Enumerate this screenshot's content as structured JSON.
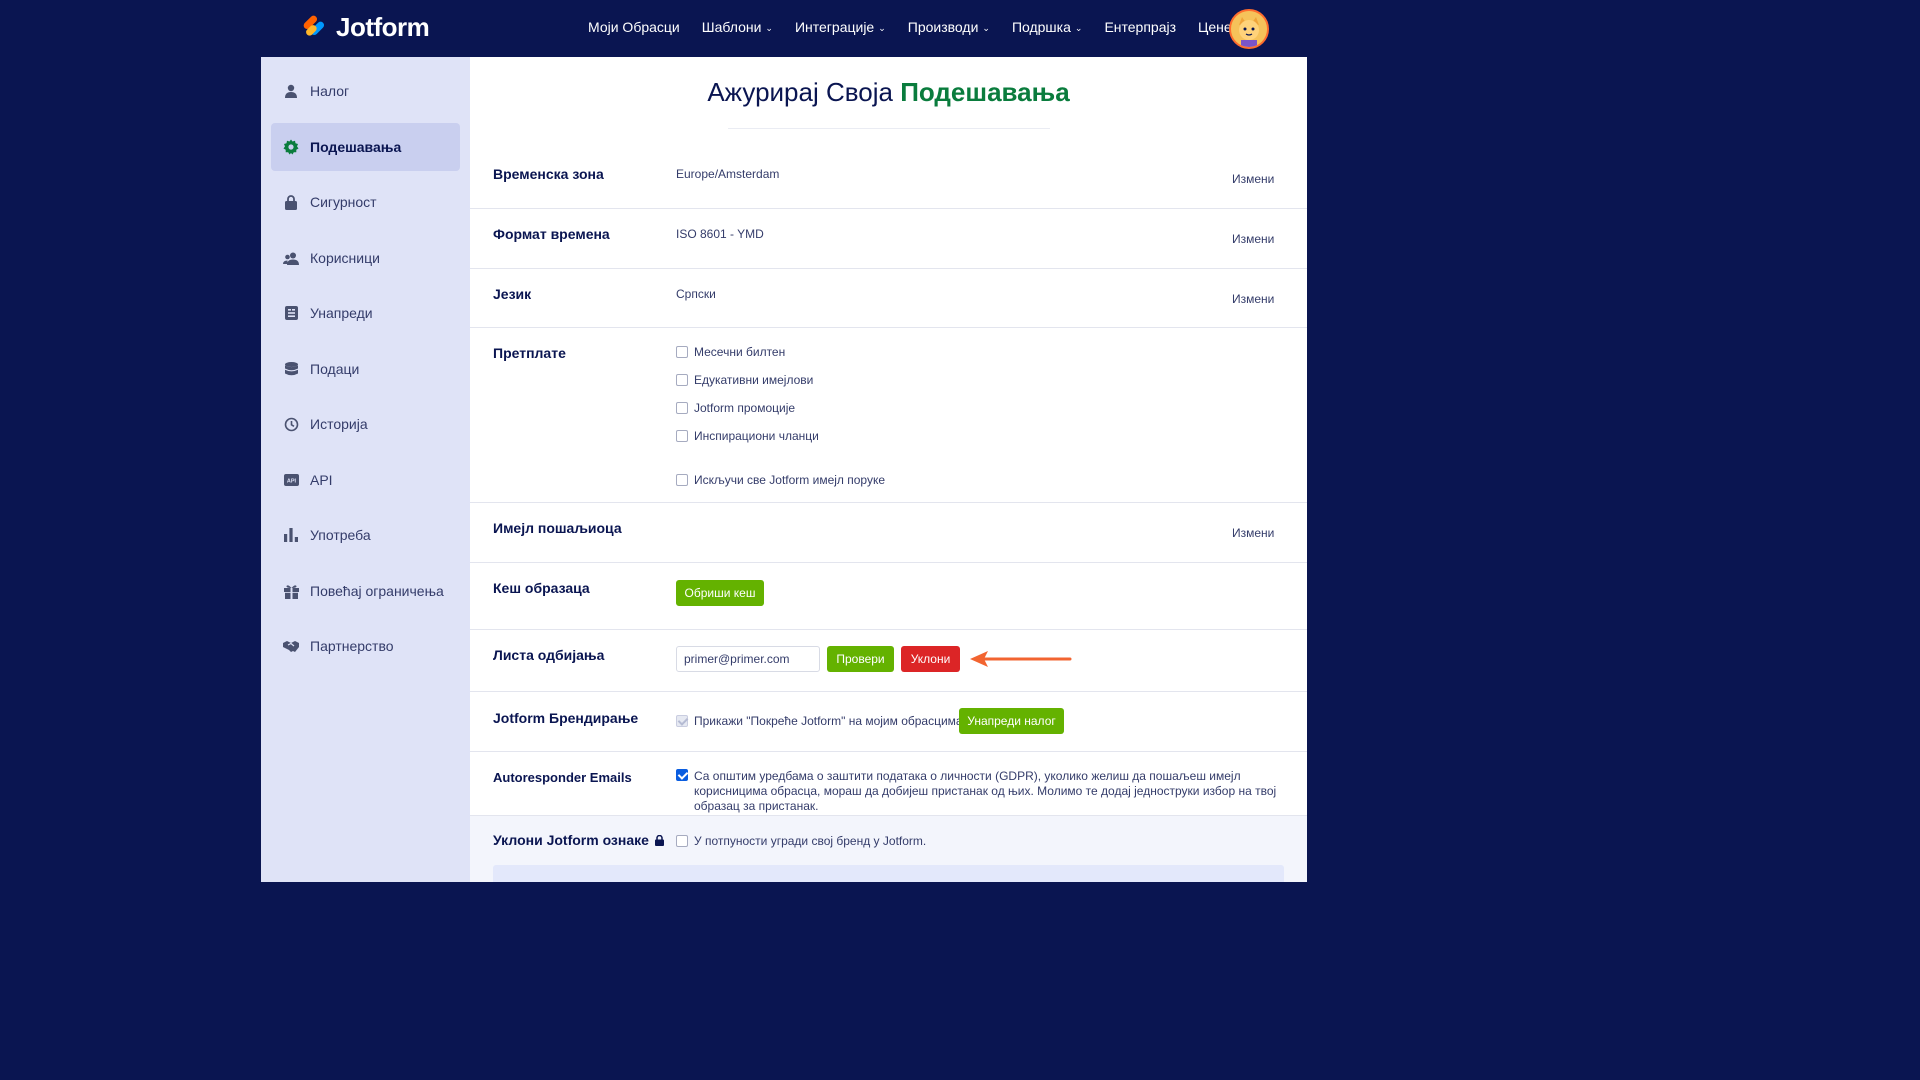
{
  "brand": {
    "name": "Jotform",
    "colors": {
      "navy": "#0a1551",
      "green": "#0a7c3d",
      "button_green": "#64b200",
      "red": "#dc2526",
      "orange": "#ff6d2e"
    }
  },
  "nav": {
    "items": [
      {
        "label": "Моји Обрасци",
        "dropdown": false
      },
      {
        "label": "Шаблони",
        "dropdown": true
      },
      {
        "label": "Интеграције",
        "dropdown": true
      },
      {
        "label": "Производи",
        "dropdown": true
      },
      {
        "label": "Подршка",
        "dropdown": true
      },
      {
        "label": "Ентерпрајз",
        "dropdown": false
      },
      {
        "label": "Цене",
        "dropdown": false
      }
    ]
  },
  "sidebar": {
    "items": [
      {
        "label": "Налог",
        "icon": "user-icon"
      },
      {
        "label": "Подешавања",
        "icon": "gear-icon",
        "active": true
      },
      {
        "label": "Сигурност",
        "icon": "lock-icon"
      },
      {
        "label": "Корисници",
        "icon": "users-icon"
      },
      {
        "label": "Унапреди",
        "icon": "upgrade-icon"
      },
      {
        "label": "Подаци",
        "icon": "database-icon"
      },
      {
        "label": "Историја",
        "icon": "history-icon"
      },
      {
        "label": "API",
        "icon": "api-icon"
      },
      {
        "label": "Употреба",
        "icon": "chart-icon"
      },
      {
        "label": "Повећај ограничења",
        "icon": "gift-icon"
      },
      {
        "label": "Партнерство",
        "icon": "handshake-icon"
      }
    ]
  },
  "page": {
    "title_prefix": "Ажурирај Своја",
    "title_accent": "Подешавања",
    "edit_label": "Измени"
  },
  "settings": {
    "timezone": {
      "label": "Временска зона",
      "value": "Europe/Amsterdam"
    },
    "time_format": {
      "label": "Формат времена",
      "value": "ISO 8601 - YMD"
    },
    "language": {
      "label": "Језик",
      "value": "Српски"
    },
    "subscriptions": {
      "label": "Претплате",
      "options": [
        "Месечни билтен",
        "Едукативни имејлови",
        "Jotform промоције",
        "Инспирациони чланци"
      ],
      "unsubscribe_all": "Искључи све Jotform имејл поруке"
    },
    "sender_email": {
      "label": "Имејл пошаљиоца"
    },
    "form_cache": {
      "label": "Кеш образаца",
      "button": "Обриши кеш"
    },
    "bounce_list": {
      "label": "Листа одбијања",
      "input_value": "primer@primer.com",
      "check_button": "Провери",
      "remove_button": "Уклони"
    },
    "branding": {
      "label": "Jotform Брендирање",
      "checkbox": "Прикажи \"Покреће Jotform\" на мојим обрасцима",
      "button": "Унапреди налог"
    },
    "autoresponder": {
      "label": "Autoresponder Emails",
      "text": "Са општим уредбама о заштити података о личности (GDPR), уколико желиш да пошаљеш имејл корисницима обрасца, мораш да добијеш пристанак од њих. Молимо те додај једноструки избор на твој образац за пристанак."
    },
    "remove_marks": {
      "label": "Уклони Jotform ознаке",
      "checkbox": "У потпуности угради свој бренд у Jotform."
    }
  }
}
